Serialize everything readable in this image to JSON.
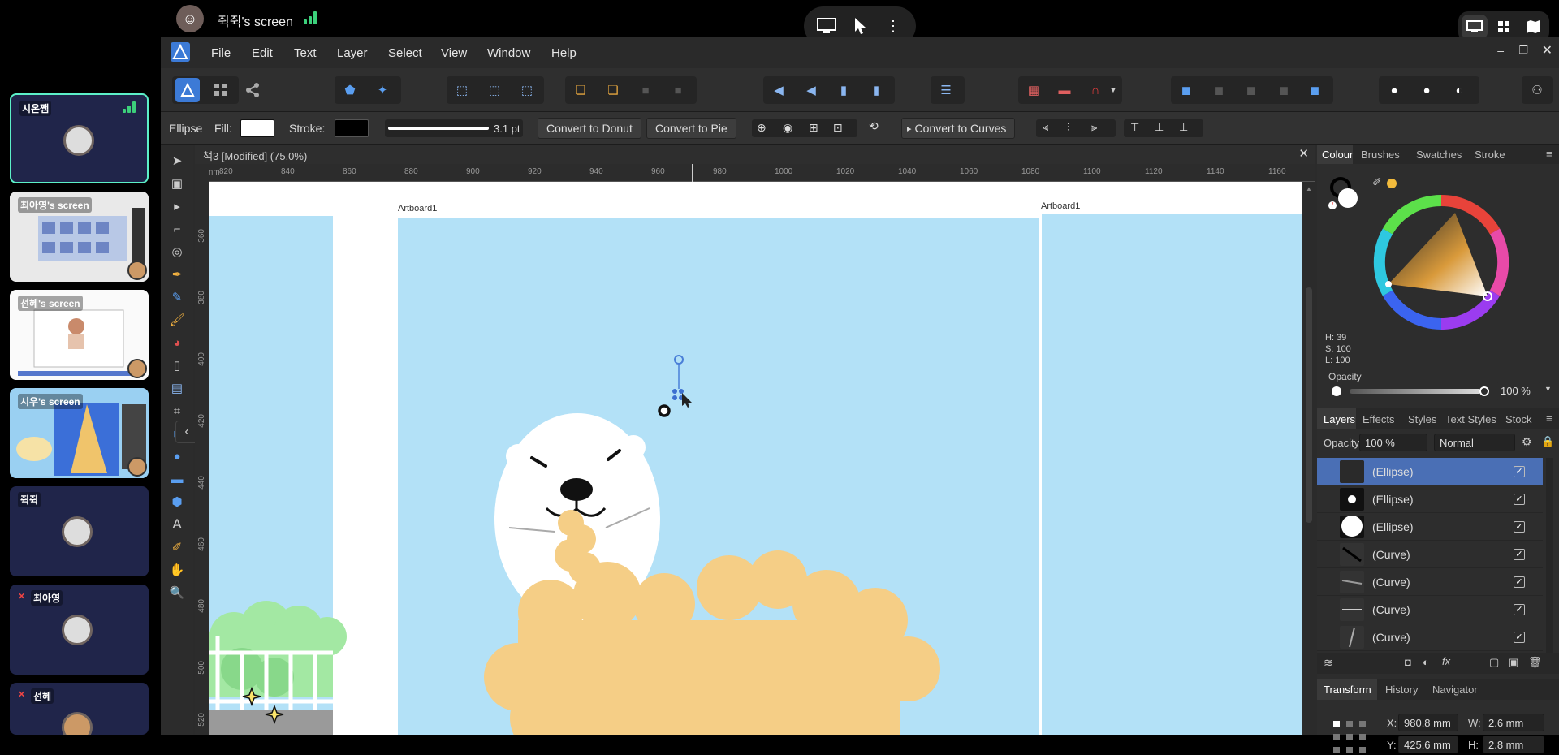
{
  "call": {
    "host_screen_title": "쥑쥑's screen",
    "signal_color": "#3cd07b",
    "controls": [
      "monitor-icon",
      "pointer-icon",
      "more-icon"
    ],
    "view_modes": [
      "screen-icon",
      "grid-icon",
      "map-icon"
    ]
  },
  "participants": [
    {
      "name": "시온쨈",
      "type": "camera-off",
      "active": true
    },
    {
      "name": "최아영's screen",
      "type": "screen"
    },
    {
      "name": "선혜's screen",
      "type": "screen"
    },
    {
      "name": "시우's screen",
      "type": "screen"
    },
    {
      "name": "쥑쥑",
      "type": "camera-off"
    },
    {
      "name": "최아영",
      "type": "camera-off",
      "muted": true
    },
    {
      "name": "선혜",
      "type": "camera-off",
      "muted": true
    }
  ],
  "app": {
    "menu": [
      "File",
      "Edit",
      "Text",
      "Layer",
      "Select",
      "View",
      "Window",
      "Help"
    ],
    "accent": "#4a6fb5",
    "context": {
      "shape": "Ellipse",
      "fill_label": "Fill:",
      "stroke_label": "Stroke:",
      "stroke_width": "3.1 pt",
      "btn_donut": "Convert to Donut",
      "btn_pie": "Convert to Pie",
      "btn_curves": "Convert to Curves"
    },
    "doc_title": "책3 [Modified] (75.0%)",
    "ruler_top": [
      "820",
      "840",
      "860",
      "880",
      "900",
      "920",
      "940",
      "960",
      "980",
      "1000",
      "1020",
      "1040",
      "1060",
      "1080",
      "1100",
      "1120",
      "1140",
      "1160"
    ],
    "ruler_left": [
      "360",
      "380",
      "400",
      "420",
      "440",
      "460",
      "480",
      "500",
      "520"
    ],
    "artboard_label_1": "Artboard1",
    "artboard_label_2": "Artboard1",
    "colors": {
      "sky": "#b3e1f7",
      "bear": "#ffffff",
      "cloud": "#f5ce86",
      "bush": "#a3e8a3"
    }
  },
  "colour_panel": {
    "tabs": [
      "Colour",
      "Brushes",
      "Swatches",
      "Stroke"
    ],
    "h": "H: 39",
    "s": "S: 100",
    "l": "L: 100",
    "opacity_label": "Opacity",
    "opacity_value": "100 %"
  },
  "layers_panel": {
    "tabs": [
      "Layers",
      "Effects",
      "Styles",
      "Text Styles",
      "Stock"
    ],
    "opacity_label": "Opacity:",
    "opacity_value": "100 %",
    "blend_mode": "Normal",
    "rows": [
      {
        "name": "(Ellipse)",
        "selected": true
      },
      {
        "name": "(Ellipse)"
      },
      {
        "name": "(Ellipse)"
      },
      {
        "name": "(Curve)"
      },
      {
        "name": "(Curve)"
      },
      {
        "name": "(Curve)"
      },
      {
        "name": "(Curve)"
      }
    ]
  },
  "transform_panel": {
    "tabs": [
      "Transform",
      "History",
      "Navigator"
    ],
    "x_label": "X:",
    "x": "980.8 mm",
    "y_label": "Y:",
    "y": "425.6 mm",
    "w_label": "W:",
    "w": "2.6 mm",
    "h_label": "H:",
    "h": "2.8 mm"
  }
}
